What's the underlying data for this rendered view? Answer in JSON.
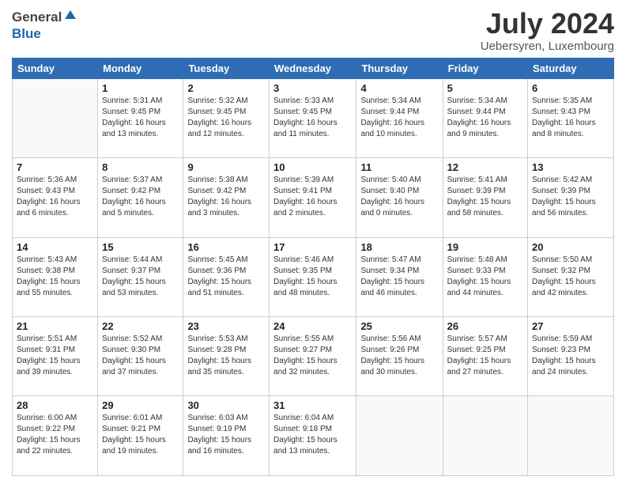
{
  "header": {
    "logo_general": "General",
    "logo_blue": "Blue",
    "month": "July 2024",
    "location": "Uebersyren, Luxembourg"
  },
  "weekdays": [
    "Sunday",
    "Monday",
    "Tuesday",
    "Wednesday",
    "Thursday",
    "Friday",
    "Saturday"
  ],
  "weeks": [
    [
      {
        "date": "",
        "info": ""
      },
      {
        "date": "1",
        "info": "Sunrise: 5:31 AM\nSunset: 9:45 PM\nDaylight: 16 hours\nand 13 minutes."
      },
      {
        "date": "2",
        "info": "Sunrise: 5:32 AM\nSunset: 9:45 PM\nDaylight: 16 hours\nand 12 minutes."
      },
      {
        "date": "3",
        "info": "Sunrise: 5:33 AM\nSunset: 9:45 PM\nDaylight: 16 hours\nand 11 minutes."
      },
      {
        "date": "4",
        "info": "Sunrise: 5:34 AM\nSunset: 9:44 PM\nDaylight: 16 hours\nand 10 minutes."
      },
      {
        "date": "5",
        "info": "Sunrise: 5:34 AM\nSunset: 9:44 PM\nDaylight: 16 hours\nand 9 minutes."
      },
      {
        "date": "6",
        "info": "Sunrise: 5:35 AM\nSunset: 9:43 PM\nDaylight: 16 hours\nand 8 minutes."
      }
    ],
    [
      {
        "date": "7",
        "info": "Sunrise: 5:36 AM\nSunset: 9:43 PM\nDaylight: 16 hours\nand 6 minutes."
      },
      {
        "date": "8",
        "info": "Sunrise: 5:37 AM\nSunset: 9:42 PM\nDaylight: 16 hours\nand 5 minutes."
      },
      {
        "date": "9",
        "info": "Sunrise: 5:38 AM\nSunset: 9:42 PM\nDaylight: 16 hours\nand 3 minutes."
      },
      {
        "date": "10",
        "info": "Sunrise: 5:39 AM\nSunset: 9:41 PM\nDaylight: 16 hours\nand 2 minutes."
      },
      {
        "date": "11",
        "info": "Sunrise: 5:40 AM\nSunset: 9:40 PM\nDaylight: 16 hours\nand 0 minutes."
      },
      {
        "date": "12",
        "info": "Sunrise: 5:41 AM\nSunset: 9:39 PM\nDaylight: 15 hours\nand 58 minutes."
      },
      {
        "date": "13",
        "info": "Sunrise: 5:42 AM\nSunset: 9:39 PM\nDaylight: 15 hours\nand 56 minutes."
      }
    ],
    [
      {
        "date": "14",
        "info": "Sunrise: 5:43 AM\nSunset: 9:38 PM\nDaylight: 15 hours\nand 55 minutes."
      },
      {
        "date": "15",
        "info": "Sunrise: 5:44 AM\nSunset: 9:37 PM\nDaylight: 15 hours\nand 53 minutes."
      },
      {
        "date": "16",
        "info": "Sunrise: 5:45 AM\nSunset: 9:36 PM\nDaylight: 15 hours\nand 51 minutes."
      },
      {
        "date": "17",
        "info": "Sunrise: 5:46 AM\nSunset: 9:35 PM\nDaylight: 15 hours\nand 48 minutes."
      },
      {
        "date": "18",
        "info": "Sunrise: 5:47 AM\nSunset: 9:34 PM\nDaylight: 15 hours\nand 46 minutes."
      },
      {
        "date": "19",
        "info": "Sunrise: 5:48 AM\nSunset: 9:33 PM\nDaylight: 15 hours\nand 44 minutes."
      },
      {
        "date": "20",
        "info": "Sunrise: 5:50 AM\nSunset: 9:32 PM\nDaylight: 15 hours\nand 42 minutes."
      }
    ],
    [
      {
        "date": "21",
        "info": "Sunrise: 5:51 AM\nSunset: 9:31 PM\nDaylight: 15 hours\nand 39 minutes."
      },
      {
        "date": "22",
        "info": "Sunrise: 5:52 AM\nSunset: 9:30 PM\nDaylight: 15 hours\nand 37 minutes."
      },
      {
        "date": "23",
        "info": "Sunrise: 5:53 AM\nSunset: 9:28 PM\nDaylight: 15 hours\nand 35 minutes."
      },
      {
        "date": "24",
        "info": "Sunrise: 5:55 AM\nSunset: 9:27 PM\nDaylight: 15 hours\nand 32 minutes."
      },
      {
        "date": "25",
        "info": "Sunrise: 5:56 AM\nSunset: 9:26 PM\nDaylight: 15 hours\nand 30 minutes."
      },
      {
        "date": "26",
        "info": "Sunrise: 5:57 AM\nSunset: 9:25 PM\nDaylight: 15 hours\nand 27 minutes."
      },
      {
        "date": "27",
        "info": "Sunrise: 5:59 AM\nSunset: 9:23 PM\nDaylight: 15 hours\nand 24 minutes."
      }
    ],
    [
      {
        "date": "28",
        "info": "Sunrise: 6:00 AM\nSunset: 9:22 PM\nDaylight: 15 hours\nand 22 minutes."
      },
      {
        "date": "29",
        "info": "Sunrise: 6:01 AM\nSunset: 9:21 PM\nDaylight: 15 hours\nand 19 minutes."
      },
      {
        "date": "30",
        "info": "Sunrise: 6:03 AM\nSunset: 9:19 PM\nDaylight: 15 hours\nand 16 minutes."
      },
      {
        "date": "31",
        "info": "Sunrise: 6:04 AM\nSunset: 9:18 PM\nDaylight: 15 hours\nand 13 minutes."
      },
      {
        "date": "",
        "info": ""
      },
      {
        "date": "",
        "info": ""
      },
      {
        "date": "",
        "info": ""
      }
    ]
  ]
}
